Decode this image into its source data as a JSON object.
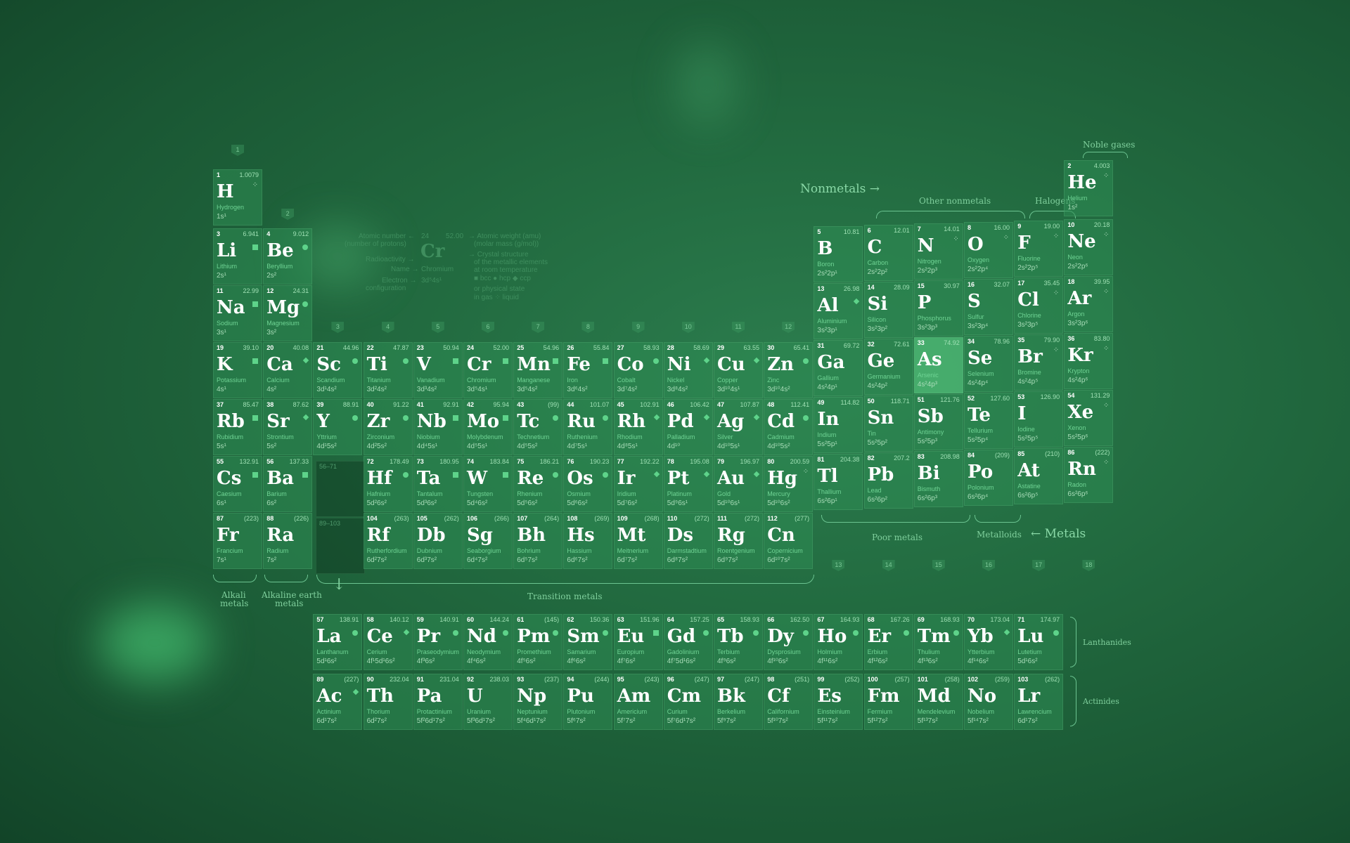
{
  "colors": {
    "background": "#1f6a3f",
    "cell": "#2e8c54",
    "accent": "#5ed38a"
  },
  "group_numbers": [
    "1",
    "2",
    "3",
    "4",
    "5",
    "6",
    "7",
    "8",
    "9",
    "10",
    "11",
    "12",
    "13",
    "14",
    "15",
    "16",
    "17",
    "18"
  ],
  "placeholders": {
    "lanthanide_range": "56–71",
    "actinide_range": "89–103"
  },
  "legend": {
    "atomic_number": "Atomic number ←",
    "number_of_protons": "(number of protons)",
    "radioactivity": "Radioactivity →",
    "name": "Name →",
    "electron": "Electron →",
    "configuration": "configuration",
    "sample_number": "24",
    "sample_mass": "52.00",
    "sample_symbol": "Cr",
    "sample_name": "Chromium",
    "sample_config": "3d⁵4s¹",
    "atomic_weight": "→ Atomic weight (amu)",
    "molar_mass": "(molar mass (g/mol))",
    "crystal_structure": "→ Crystal structure",
    "of_metallic": "of the metallic elements",
    "at_room_temp": "at room temperature",
    "structures": "■ bcc   ● hcp   ◆ ccp",
    "physical_state": "or physical state",
    "states": "in gas  ⁘ liquid"
  },
  "labels": {
    "noble_gases": "Noble gases",
    "nonmetals": "Nonmetals →",
    "other_nonmetals": "Other nonmetals",
    "halogens": "Halogens",
    "poor_metals": "Poor metals",
    "metalloids": "Metalloids",
    "metals": "← Metals",
    "transition_metals": "Transition metals",
    "alkali_metals_1": "Alkali",
    "alkali_metals_2": "metals",
    "alkaline_earth_1": "Alkaline earth",
    "alkaline_earth_2": "metals",
    "lanthanides": "Lanthanides",
    "actinides": "Actinides"
  },
  "elements": [
    {
      "n": "1",
      "m": "1.0079",
      "s": "H",
      "name": "Hydrogen",
      "c": "1s¹",
      "col": 1,
      "row": 1,
      "mk": "dots"
    },
    {
      "n": "2",
      "m": "4.003",
      "s": "He",
      "name": "Helium",
      "c": "1s²",
      "col": 18,
      "row": 1,
      "mk": "dots"
    },
    {
      "n": "3",
      "m": "6.941",
      "s": "Li",
      "name": "Lithium",
      "c": "2s¹",
      "col": 1,
      "row": 2,
      "mk": "sq"
    },
    {
      "n": "4",
      "m": "9.012",
      "s": "Be",
      "name": "Beryllium",
      "c": "2s²",
      "col": 2,
      "row": 2,
      "mk": "circle"
    },
    {
      "n": "5",
      "m": "10.81",
      "s": "B",
      "name": "Boron",
      "c": "2s²2p¹",
      "col": 13,
      "row": 2
    },
    {
      "n": "6",
      "m": "12.01",
      "s": "C",
      "name": "Carbon",
      "c": "2s²2p²",
      "col": 14,
      "row": 2
    },
    {
      "n": "7",
      "m": "14.01",
      "s": "N",
      "name": "Nitrogen",
      "c": "2s²2p³",
      "col": 15,
      "row": 2,
      "mk": "dots"
    },
    {
      "n": "8",
      "m": "16.00",
      "s": "O",
      "name": "Oxygen",
      "c": "2s²2p⁴",
      "col": 16,
      "row": 2,
      "mk": "dots"
    },
    {
      "n": "9",
      "m": "19.00",
      "s": "F",
      "name": "Fluorine",
      "c": "2s²2p⁵",
      "col": 17,
      "row": 2,
      "mk": "dots"
    },
    {
      "n": "10",
      "m": "20.18",
      "s": "Ne",
      "name": "Neon",
      "c": "2s²2p⁶",
      "col": 18,
      "row": 2,
      "mk": "dots"
    },
    {
      "n": "11",
      "m": "22.99",
      "s": "Na",
      "name": "Sodium",
      "c": "3s¹",
      "col": 1,
      "row": 3,
      "mk": "sq"
    },
    {
      "n": "12",
      "m": "24.31",
      "s": "Mg",
      "name": "Magnesium",
      "c": "3s²",
      "col": 2,
      "row": 3,
      "mk": "circle"
    },
    {
      "n": "13",
      "m": "26.98",
      "s": "Al",
      "name": "Aluminium",
      "c": "3s²3p¹",
      "col": 13,
      "row": 3,
      "mk": "diamond"
    },
    {
      "n": "14",
      "m": "28.09",
      "s": "Si",
      "name": "Silicon",
      "c": "3s²3p²",
      "col": 14,
      "row": 3
    },
    {
      "n": "15",
      "m": "30.97",
      "s": "P",
      "name": "Phosphorus",
      "c": "3s²3p³",
      "col": 15,
      "row": 3
    },
    {
      "n": "16",
      "m": "32.07",
      "s": "S",
      "name": "Sulfur",
      "c": "3s²3p⁴",
      "col": 16,
      "row": 3
    },
    {
      "n": "17",
      "m": "35.45",
      "s": "Cl",
      "name": "Chlorine",
      "c": "3s²3p⁵",
      "col": 17,
      "row": 3,
      "mk": "dots"
    },
    {
      "n": "18",
      "m": "39.95",
      "s": "Ar",
      "name": "Argon",
      "c": "3s²3p⁶",
      "col": 18,
      "row": 3,
      "mk": "dots"
    },
    {
      "n": "19",
      "m": "39.10",
      "s": "K",
      "name": "Potassium",
      "c": "4s¹",
      "col": 1,
      "row": 4,
      "mk": "sq"
    },
    {
      "n": "20",
      "m": "40.08",
      "s": "Ca",
      "name": "Calcium",
      "c": "4s²",
      "col": 2,
      "row": 4,
      "mk": "diamond"
    },
    {
      "n": "21",
      "m": "44.96",
      "s": "Sc",
      "name": "Scandium",
      "c": "3d¹4s²",
      "col": 3,
      "row": 4,
      "mk": "circle"
    },
    {
      "n": "22",
      "m": "47.87",
      "s": "Ti",
      "name": "Titanium",
      "c": "3d²4s²",
      "col": 4,
      "row": 4,
      "mk": "circle"
    },
    {
      "n": "23",
      "m": "50.94",
      "s": "V",
      "name": "Vanadium",
      "c": "3d³4s²",
      "col": 5,
      "row": 4,
      "mk": "sq"
    },
    {
      "n": "24",
      "m": "52.00",
      "s": "Cr",
      "name": "Chromium",
      "c": "3d⁵4s¹",
      "col": 6,
      "row": 4,
      "mk": "sq"
    },
    {
      "n": "25",
      "m": "54.96",
      "s": "Mn",
      "name": "Manganese",
      "c": "3d⁵4s²",
      "col": 7,
      "row": 4,
      "mk": "sq"
    },
    {
      "n": "26",
      "m": "55.84",
      "s": "Fe",
      "name": "Iron",
      "c": "3d⁶4s²",
      "col": 8,
      "row": 4,
      "mk": "sq"
    },
    {
      "n": "27",
      "m": "58.93",
      "s": "Co",
      "name": "Cobalt",
      "c": "3d⁷4s²",
      "col": 9,
      "row": 4,
      "mk": "circle"
    },
    {
      "n": "28",
      "m": "58.69",
      "s": "Ni",
      "name": "Nickel",
      "c": "3d⁸4s²",
      "col": 10,
      "row": 4,
      "mk": "diamond"
    },
    {
      "n": "29",
      "m": "63.55",
      "s": "Cu",
      "name": "Copper",
      "c": "3d¹⁰4s¹",
      "col": 11,
      "row": 4,
      "mk": "diamond"
    },
    {
      "n": "30",
      "m": "65.41",
      "s": "Zn",
      "name": "Zinc",
      "c": "3d¹⁰4s²",
      "col": 12,
      "row": 4,
      "mk": "circle"
    },
    {
      "n": "31",
      "m": "69.72",
      "s": "Ga",
      "name": "Gallium",
      "c": "4s²4p¹",
      "col": 13,
      "row": 4
    },
    {
      "n": "32",
      "m": "72.61",
      "s": "Ge",
      "name": "Germanium",
      "c": "4s²4p²",
      "col": 14,
      "row": 4
    },
    {
      "n": "33",
      "m": "74.92",
      "s": "As",
      "name": "Arsenic",
      "c": "4s²4p³",
      "col": 15,
      "row": 4
    },
    {
      "n": "34",
      "m": "78.96",
      "s": "Se",
      "name": "Selenium",
      "c": "4s²4p⁴",
      "col": 16,
      "row": 4
    },
    {
      "n": "35",
      "m": "79.90",
      "s": "Br",
      "name": "Bromine",
      "c": "4s²4p⁵",
      "col": 17,
      "row": 4,
      "mk": "dots"
    },
    {
      "n": "36",
      "m": "83.80",
      "s": "Kr",
      "name": "Krypton",
      "c": "4s²4p⁶",
      "col": 18,
      "row": 4,
      "mk": "dots"
    },
    {
      "n": "37",
      "m": "85.47",
      "s": "Rb",
      "name": "Rubidium",
      "c": "5s¹",
      "col": 1,
      "row": 5,
      "mk": "sq"
    },
    {
      "n": "38",
      "m": "87.62",
      "s": "Sr",
      "name": "Strontium",
      "c": "5s²",
      "col": 2,
      "row": 5,
      "mk": "diamond"
    },
    {
      "n": "39",
      "m": "88.91",
      "s": "Y",
      "name": "Yttrium",
      "c": "4d¹5s²",
      "col": 3,
      "row": 5,
      "mk": "circle"
    },
    {
      "n": "40",
      "m": "91.22",
      "s": "Zr",
      "name": "Zirconium",
      "c": "4d²5s²",
      "col": 4,
      "row": 5,
      "mk": "circle"
    },
    {
      "n": "41",
      "m": "92.91",
      "s": "Nb",
      "name": "Niobium",
      "c": "4d⁴5s¹",
      "col": 5,
      "row": 5,
      "mk": "sq"
    },
    {
      "n": "42",
      "m": "95.94",
      "s": "Mo",
      "name": "Molybdenum",
      "c": "4d⁵5s¹",
      "col": 6,
      "row": 5,
      "mk": "sq"
    },
    {
      "n": "43",
      "m": "(99)",
      "s": "Tc",
      "name": "Technetium",
      "c": "4d⁵5s²",
      "col": 7,
      "row": 5,
      "mk": "circle"
    },
    {
      "n": "44",
      "m": "101.07",
      "s": "Ru",
      "name": "Ruthenium",
      "c": "4d⁷5s¹",
      "col": 8,
      "row": 5,
      "mk": "circle"
    },
    {
      "n": "45",
      "m": "102.91",
      "s": "Rh",
      "name": "Rhodium",
      "c": "4d⁸5s¹",
      "col": 9,
      "row": 5,
      "mk": "diamond"
    },
    {
      "n": "46",
      "m": "106.42",
      "s": "Pd",
      "name": "Palladium",
      "c": "4d¹⁰",
      "col": 10,
      "row": 5,
      "mk": "diamond"
    },
    {
      "n": "47",
      "m": "107.87",
      "s": "Ag",
      "name": "Silver",
      "c": "4d¹⁰5s¹",
      "col": 11,
      "row": 5,
      "mk": "diamond"
    },
    {
      "n": "48",
      "m": "112.41",
      "s": "Cd",
      "name": "Cadmium",
      "c": "4d¹⁰5s²",
      "col": 12,
      "row": 5,
      "mk": "circle"
    },
    {
      "n": "49",
      "m": "114.82",
      "s": "In",
      "name": "Indium",
      "c": "5s²5p¹",
      "col": 13,
      "row": 5
    },
    {
      "n": "50",
      "m": "118.71",
      "s": "Sn",
      "name": "Tin",
      "c": "5s²5p²",
      "col": 14,
      "row": 5
    },
    {
      "n": "51",
      "m": "121.76",
      "s": "Sb",
      "name": "Antimony",
      "c": "5s²5p³",
      "col": 15,
      "row": 5
    },
    {
      "n": "52",
      "m": "127.60",
      "s": "Te",
      "name": "Tellurium",
      "c": "5s²5p⁴",
      "col": 16,
      "row": 5
    },
    {
      "n": "53",
      "m": "126.90",
      "s": "I",
      "name": "Iodine",
      "c": "5s²5p⁵",
      "col": 17,
      "row": 5
    },
    {
      "n": "54",
      "m": "131.29",
      "s": "Xe",
      "name": "Xenon",
      "c": "5s²5p⁶",
      "col": 18,
      "row": 5,
      "mk": "dots"
    },
    {
      "n": "55",
      "m": "132.91",
      "s": "Cs",
      "name": "Caesium",
      "c": "6s¹",
      "col": 1,
      "row": 6,
      "mk": "sq"
    },
    {
      "n": "56",
      "m": "137.33",
      "s": "Ba",
      "name": "Barium",
      "c": "6s²",
      "col": 2,
      "row": 6,
      "mk": "sq"
    },
    {
      "n": "72",
      "m": "178.49",
      "s": "Hf",
      "name": "Hafnium",
      "c": "5d²6s²",
      "col": 4,
      "row": 6,
      "mk": "circle"
    },
    {
      "n": "73",
      "m": "180.95",
      "s": "Ta",
      "name": "Tantalum",
      "c": "5d³6s²",
      "col": 5,
      "row": 6,
      "mk": "sq"
    },
    {
      "n": "74",
      "m": "183.84",
      "s": "W",
      "name": "Tungsten",
      "c": "5d⁴6s²",
      "col": 6,
      "row": 6,
      "mk": "sq"
    },
    {
      "n": "75",
      "m": "186.21",
      "s": "Re",
      "name": "Rhenium",
      "c": "5d⁵6s²",
      "col": 7,
      "row": 6,
      "mk": "circle"
    },
    {
      "n": "76",
      "m": "190.23",
      "s": "Os",
      "name": "Osmium",
      "c": "5d⁶6s²",
      "col": 8,
      "row": 6,
      "mk": "circle"
    },
    {
      "n": "77",
      "m": "192.22",
      "s": "Ir",
      "name": "Iridium",
      "c": "5d⁷6s²",
      "col": 9,
      "row": 6,
      "mk": "diamond"
    },
    {
      "n": "78",
      "m": "195.08",
      "s": "Pt",
      "name": "Platinum",
      "c": "5d⁹6s¹",
      "col": 10,
      "row": 6,
      "mk": "diamond"
    },
    {
      "n": "79",
      "m": "196.97",
      "s": "Au",
      "name": "Gold",
      "c": "5d¹⁰6s¹",
      "col": 11,
      "row": 6,
      "mk": "diamond"
    },
    {
      "n": "80",
      "m": "200.59",
      "s": "Hg",
      "name": "Mercury",
      "c": "5d¹⁰6s²",
      "col": 12,
      "row": 6,
      "mk": "dots"
    },
    {
      "n": "81",
      "m": "204.38",
      "s": "Tl",
      "name": "Thallium",
      "c": "6s²6p¹",
      "col": 13,
      "row": 6
    },
    {
      "n": "82",
      "m": "207.2",
      "s": "Pb",
      "name": "Lead",
      "c": "6s²6p²",
      "col": 14,
      "row": 6
    },
    {
      "n": "83",
      "m": "208.98",
      "s": "Bi",
      "name": "Bismuth",
      "c": "6s²6p³",
      "col": 15,
      "row": 6
    },
    {
      "n": "84",
      "m": "(209)",
      "s": "Po",
      "name": "Polonium",
      "c": "6s²6p⁴",
      "col": 16,
      "row": 6
    },
    {
      "n": "85",
      "m": "(210)",
      "s": "At",
      "name": "Astatine",
      "c": "6s²6p⁵",
      "col": 17,
      "row": 6
    },
    {
      "n": "86",
      "m": "(222)",
      "s": "Rn",
      "name": "Radon",
      "c": "6s²6p⁶",
      "col": 18,
      "row": 6,
      "mk": "dots"
    },
    {
      "n": "87",
      "m": "(223)",
      "s": "Fr",
      "name": "Francium",
      "c": "7s¹",
      "col": 1,
      "row": 7
    },
    {
      "n": "88",
      "m": "(226)",
      "s": "Ra",
      "name": "Radium",
      "c": "7s²",
      "col": 2,
      "row": 7
    },
    {
      "n": "104",
      "m": "(263)",
      "s": "Rf",
      "name": "Rutherfordium",
      "c": "6d²7s²",
      "col": 4,
      "row": 7
    },
    {
      "n": "105",
      "m": "(262)",
      "s": "Db",
      "name": "Dubnium",
      "c": "6d³7s²",
      "col": 5,
      "row": 7
    },
    {
      "n": "106",
      "m": "(266)",
      "s": "Sg",
      "name": "Seaborgium",
      "c": "6d⁴7s²",
      "col": 6,
      "row": 7
    },
    {
      "n": "107",
      "m": "(264)",
      "s": "Bh",
      "name": "Bohrium",
      "c": "6d⁵7s²",
      "col": 7,
      "row": 7
    },
    {
      "n": "108",
      "m": "(269)",
      "s": "Hs",
      "name": "Hassium",
      "c": "6d⁶7s²",
      "col": 8,
      "row": 7
    },
    {
      "n": "109",
      "m": "(268)",
      "s": "Mt",
      "name": "Meitnerium",
      "c": "6d⁷7s²",
      "col": 9,
      "row": 7
    },
    {
      "n": "110",
      "m": "(272)",
      "s": "Ds",
      "name": "Darmstadtium",
      "c": "6d⁸7s²",
      "col": 10,
      "row": 7
    },
    {
      "n": "111",
      "m": "(272)",
      "s": "Rg",
      "name": "Roentgenium",
      "c": "6d⁹7s²",
      "col": 11,
      "row": 7
    },
    {
      "n": "112",
      "m": "(277)",
      "s": "Cn",
      "name": "Copernicium",
      "c": "6d¹⁰7s²",
      "col": 12,
      "row": 7
    },
    {
      "n": "57",
      "m": "138.91",
      "s": "La",
      "name": "Lanthanum",
      "c": "5d¹6s²",
      "col": 3,
      "row": 9,
      "mk": "circle"
    },
    {
      "n": "58",
      "m": "140.12",
      "s": "Ce",
      "name": "Cerium",
      "c": "4f¹5d¹6s²",
      "col": 4,
      "row": 9,
      "mk": "diamond"
    },
    {
      "n": "59",
      "m": "140.91",
      "s": "Pr",
      "name": "Praseodymium",
      "c": "4f³6s²",
      "col": 5,
      "row": 9,
      "mk": "circle"
    },
    {
      "n": "60",
      "m": "144.24",
      "s": "Nd",
      "name": "Neodymium",
      "c": "4f⁴6s²",
      "col": 6,
      "row": 9,
      "mk": "circle"
    },
    {
      "n": "61",
      "m": "(145)",
      "s": "Pm",
      "name": "Promethium",
      "c": "4f⁵6s²",
      "col": 7,
      "row": 9,
      "mk": "circle"
    },
    {
      "n": "62",
      "m": "150.36",
      "s": "Sm",
      "name": "Samarium",
      "c": "4f⁶6s²",
      "col": 8,
      "row": 9,
      "mk": "circle"
    },
    {
      "n": "63",
      "m": "151.96",
      "s": "Eu",
      "name": "Europium",
      "c": "4f⁷6s²",
      "col": 9,
      "row": 9,
      "mk": "sq"
    },
    {
      "n": "64",
      "m": "157.25",
      "s": "Gd",
      "name": "Gadolinium",
      "c": "4f⁷5d¹6s²",
      "col": 10,
      "row": 9,
      "mk": "circle"
    },
    {
      "n": "65",
      "m": "158.93",
      "s": "Tb",
      "name": "Terbium",
      "c": "4f⁹6s²",
      "col": 11,
      "row": 9,
      "mk": "circle"
    },
    {
      "n": "66",
      "m": "162.50",
      "s": "Dy",
      "name": "Dysprosium",
      "c": "4f¹⁰6s²",
      "col": 12,
      "row": 9,
      "mk": "circle"
    },
    {
      "n": "67",
      "m": "164.93",
      "s": "Ho",
      "name": "Holmium",
      "c": "4f¹¹6s²",
      "col": 13,
      "row": 9,
      "mk": "circle"
    },
    {
      "n": "68",
      "m": "167.26",
      "s": "Er",
      "name": "Erbium",
      "c": "4f¹²6s²",
      "col": 14,
      "row": 9,
      "mk": "circle"
    },
    {
      "n": "69",
      "m": "168.93",
      "s": "Tm",
      "name": "Thulium",
      "c": "4f¹³6s²",
      "col": 15,
      "row": 9,
      "mk": "circle"
    },
    {
      "n": "70",
      "m": "173.04",
      "s": "Yb",
      "name": "Ytterbium",
      "c": "4f¹⁴6s²",
      "col": 16,
      "row": 9,
      "mk": "diamond"
    },
    {
      "n": "71",
      "m": "174.97",
      "s": "Lu",
      "name": "Lutetium",
      "c": "5d¹6s²",
      "col": 17,
      "row": 9,
      "mk": "circle"
    },
    {
      "n": "89",
      "m": "(227)",
      "s": "Ac",
      "name": "Actinium",
      "c": "6d¹7s²",
      "col": 3,
      "row": 10,
      "mk": "diamond"
    },
    {
      "n": "90",
      "m": "232.04",
      "s": "Th",
      "name": "Thorium",
      "c": "6d²7s²",
      "col": 4,
      "row": 10
    },
    {
      "n": "91",
      "m": "231.04",
      "s": "Pa",
      "name": "Protactinium",
      "c": "5f²6d¹7s²",
      "col": 5,
      "row": 10
    },
    {
      "n": "92",
      "m": "238.03",
      "s": "U",
      "name": "Uranium",
      "c": "5f³6d¹7s²",
      "col": 6,
      "row": 10
    },
    {
      "n": "93",
      "m": "(237)",
      "s": "Np",
      "name": "Neptunium",
      "c": "5f⁴6d¹7s²",
      "col": 7,
      "row": 10
    },
    {
      "n": "94",
      "m": "(244)",
      "s": "Pu",
      "name": "Plutonium",
      "c": "5f⁶7s²",
      "col": 8,
      "row": 10
    },
    {
      "n": "95",
      "m": "(243)",
      "s": "Am",
      "name": "Americium",
      "c": "5f⁷7s²",
      "col": 9,
      "row": 10
    },
    {
      "n": "96",
      "m": "(247)",
      "s": "Cm",
      "name": "Curium",
      "c": "5f⁷6d¹7s²",
      "col": 10,
      "row": 10
    },
    {
      "n": "97",
      "m": "(247)",
      "s": "Bk",
      "name": "Berkelium",
      "c": "5f⁹7s²",
      "col": 11,
      "row": 10
    },
    {
      "n": "98",
      "m": "(251)",
      "s": "Cf",
      "name": "Californium",
      "c": "5f¹⁰7s²",
      "col": 12,
      "row": 10
    },
    {
      "n": "99",
      "m": "(252)",
      "s": "Es",
      "name": "Einsteinium",
      "c": "5f¹¹7s²",
      "col": 13,
      "row": 10
    },
    {
      "n": "100",
      "m": "(257)",
      "s": "Fm",
      "name": "Fermium",
      "c": "5f¹²7s²",
      "col": 14,
      "row": 10
    },
    {
      "n": "101",
      "m": "(258)",
      "s": "Md",
      "name": "Mendelevium",
      "c": "5f¹³7s²",
      "col": 15,
      "row": 10
    },
    {
      "n": "102",
      "m": "(259)",
      "s": "No",
      "name": "Nobelium",
      "c": "5f¹⁴7s²",
      "col": 16,
      "row": 10
    },
    {
      "n": "103",
      "m": "(262)",
      "s": "Lr",
      "name": "Lawrencium",
      "c": "6d¹7s²",
      "col": 17,
      "row": 10
    }
  ]
}
